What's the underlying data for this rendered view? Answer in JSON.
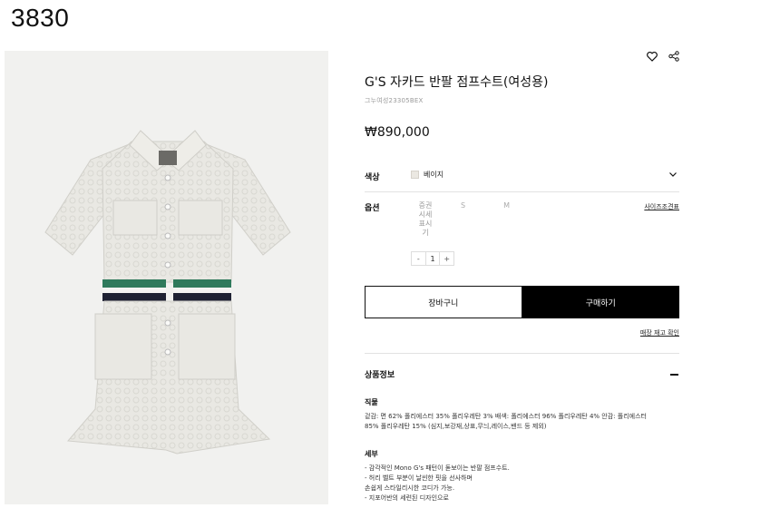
{
  "corner_id": "3830",
  "product": {
    "title": "G'S 자카드 반팔 점프수트(여성용)",
    "sku": "그누여성23305BEX",
    "price": "₩890,000"
  },
  "actions": {
    "wishlist_icon": "heart-icon",
    "share_icon": "share-icon"
  },
  "color": {
    "label": "색상",
    "selected": "베이지",
    "swatch_color": "#ebe8e2"
  },
  "options": {
    "label": "옵션",
    "sizes": [
      "증권시세표시기",
      "S",
      "M"
    ],
    "size_guide": "사이즈조견표"
  },
  "quantity": {
    "minus": "-",
    "value": "1",
    "plus": "+"
  },
  "buttons": {
    "cart": "장바구니",
    "buy": "구매하기"
  },
  "stock_link": "매장 재고 확인",
  "info_section": {
    "title": "상품정보",
    "material_title": "직물",
    "material_line1": "겉감: 면 62% 폴리에스터 35% 폴리우레탄 3% 배색: 폴리에스터 96% 폴리우레탄 4% 안감: 폴리에스터",
    "material_line2": "85% 폴리우레탄 15% (심지,보강재,상표,무늬,레이스,밴드 등 제외)",
    "detail_title": "세부",
    "detail_lines": [
      "- 감각적인 Mono G's 패턴이 돋보이는 반팔 점프수트.",
      "- 허리 벨트 부분이 날씬한 핏을 선사하며",
      "손쉽게 스타일리시한 코디가 가능.",
      "- 지포어반의 세련된 디자인으로"
    ]
  },
  "colors": {
    "accent_black": "#000000",
    "stripe_green": "#2f7a5c",
    "stripe_navy": "#1f2233",
    "image_bg": "#f1f1ef"
  }
}
